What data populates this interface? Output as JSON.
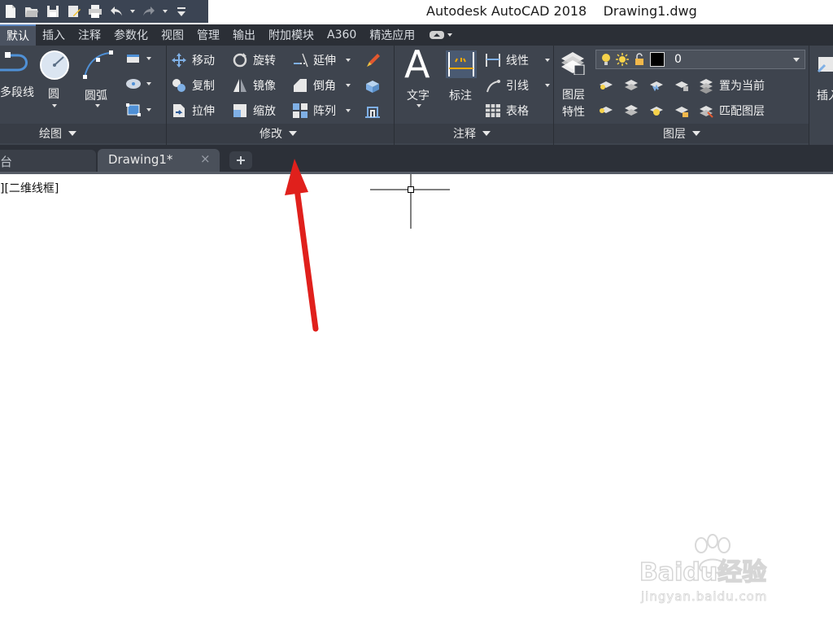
{
  "titlebar": {
    "app_title": "Autodesk AutoCAD 2018    Drawing1.dwg",
    "quick_access": [
      "new-icon",
      "open-icon",
      "save-icon",
      "saveas-icon",
      "print-icon",
      "undo-icon",
      "redo-icon",
      "customize-icon"
    ]
  },
  "ribbon_tabs": [
    {
      "label": "默认",
      "active": true
    },
    {
      "label": "插入"
    },
    {
      "label": "注释"
    },
    {
      "label": "参数化"
    },
    {
      "label": "视图"
    },
    {
      "label": "管理"
    },
    {
      "label": "输出"
    },
    {
      "label": "附加模块"
    },
    {
      "label": "A360"
    },
    {
      "label": "精选应用"
    }
  ],
  "draw_panel": {
    "title": "绘图",
    "polyline": "多段线",
    "circle": "圆",
    "arc": "圆弧"
  },
  "modify_panel": {
    "title": "修改",
    "move": "移动",
    "rotate": "旋转",
    "extend": "延伸",
    "copy": "复制",
    "mirror": "镜像",
    "chamfer": "倒角",
    "stretch": "拉伸",
    "scale": "缩放",
    "array": "阵列"
  },
  "annotation_panel": {
    "title": "注释",
    "text": "文字",
    "dimension": "标注",
    "linetype": "线性",
    "leader": "引线",
    "table": "表格"
  },
  "layers_panel": {
    "title": "图层",
    "layer_properties_1": "图层",
    "layer_properties_2": "特性",
    "current_layer": "0",
    "set_current": "置为当前",
    "match_layer": "匹配图层"
  },
  "insert_panel": {
    "insert": "插入"
  },
  "doc_tabs": {
    "start_tab": "台",
    "drawing_tab": "Drawing1*"
  },
  "canvas": {
    "viewport_label": "][二维线框]"
  },
  "watermark": {
    "brand": "Baidu经验",
    "url": "jingyan.baidu.com"
  },
  "colors": {
    "ribbon": "#3e444e",
    "active_tab": "#4a5260",
    "annotation_arrow": "#e0201c"
  }
}
